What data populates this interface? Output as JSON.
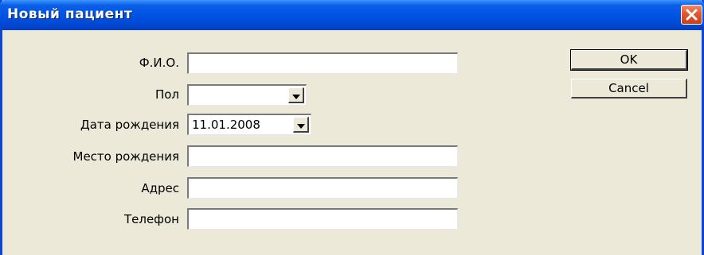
{
  "window": {
    "title": "Новый пациент"
  },
  "form": {
    "fio_label": "Ф.И.О.",
    "fio_value": "",
    "gender_label": "Пол",
    "gender_value": "",
    "birthdate_label": "Дата рождения",
    "birthdate_value": "11.01.2008",
    "birthplace_label": "Место рождения",
    "birthplace_value": "",
    "address_label": "Адрес",
    "address_value": "",
    "phone_label": "Телефон",
    "phone_value": ""
  },
  "buttons": {
    "ok_label": "OK",
    "cancel_label": "Cancel"
  },
  "icons": {
    "close": "close-icon",
    "dropdown": "chevron-down-icon"
  },
  "colors": {
    "titlebar": "#0054e3",
    "window_bg": "#ece9d8",
    "close_button": "#e2562d"
  }
}
